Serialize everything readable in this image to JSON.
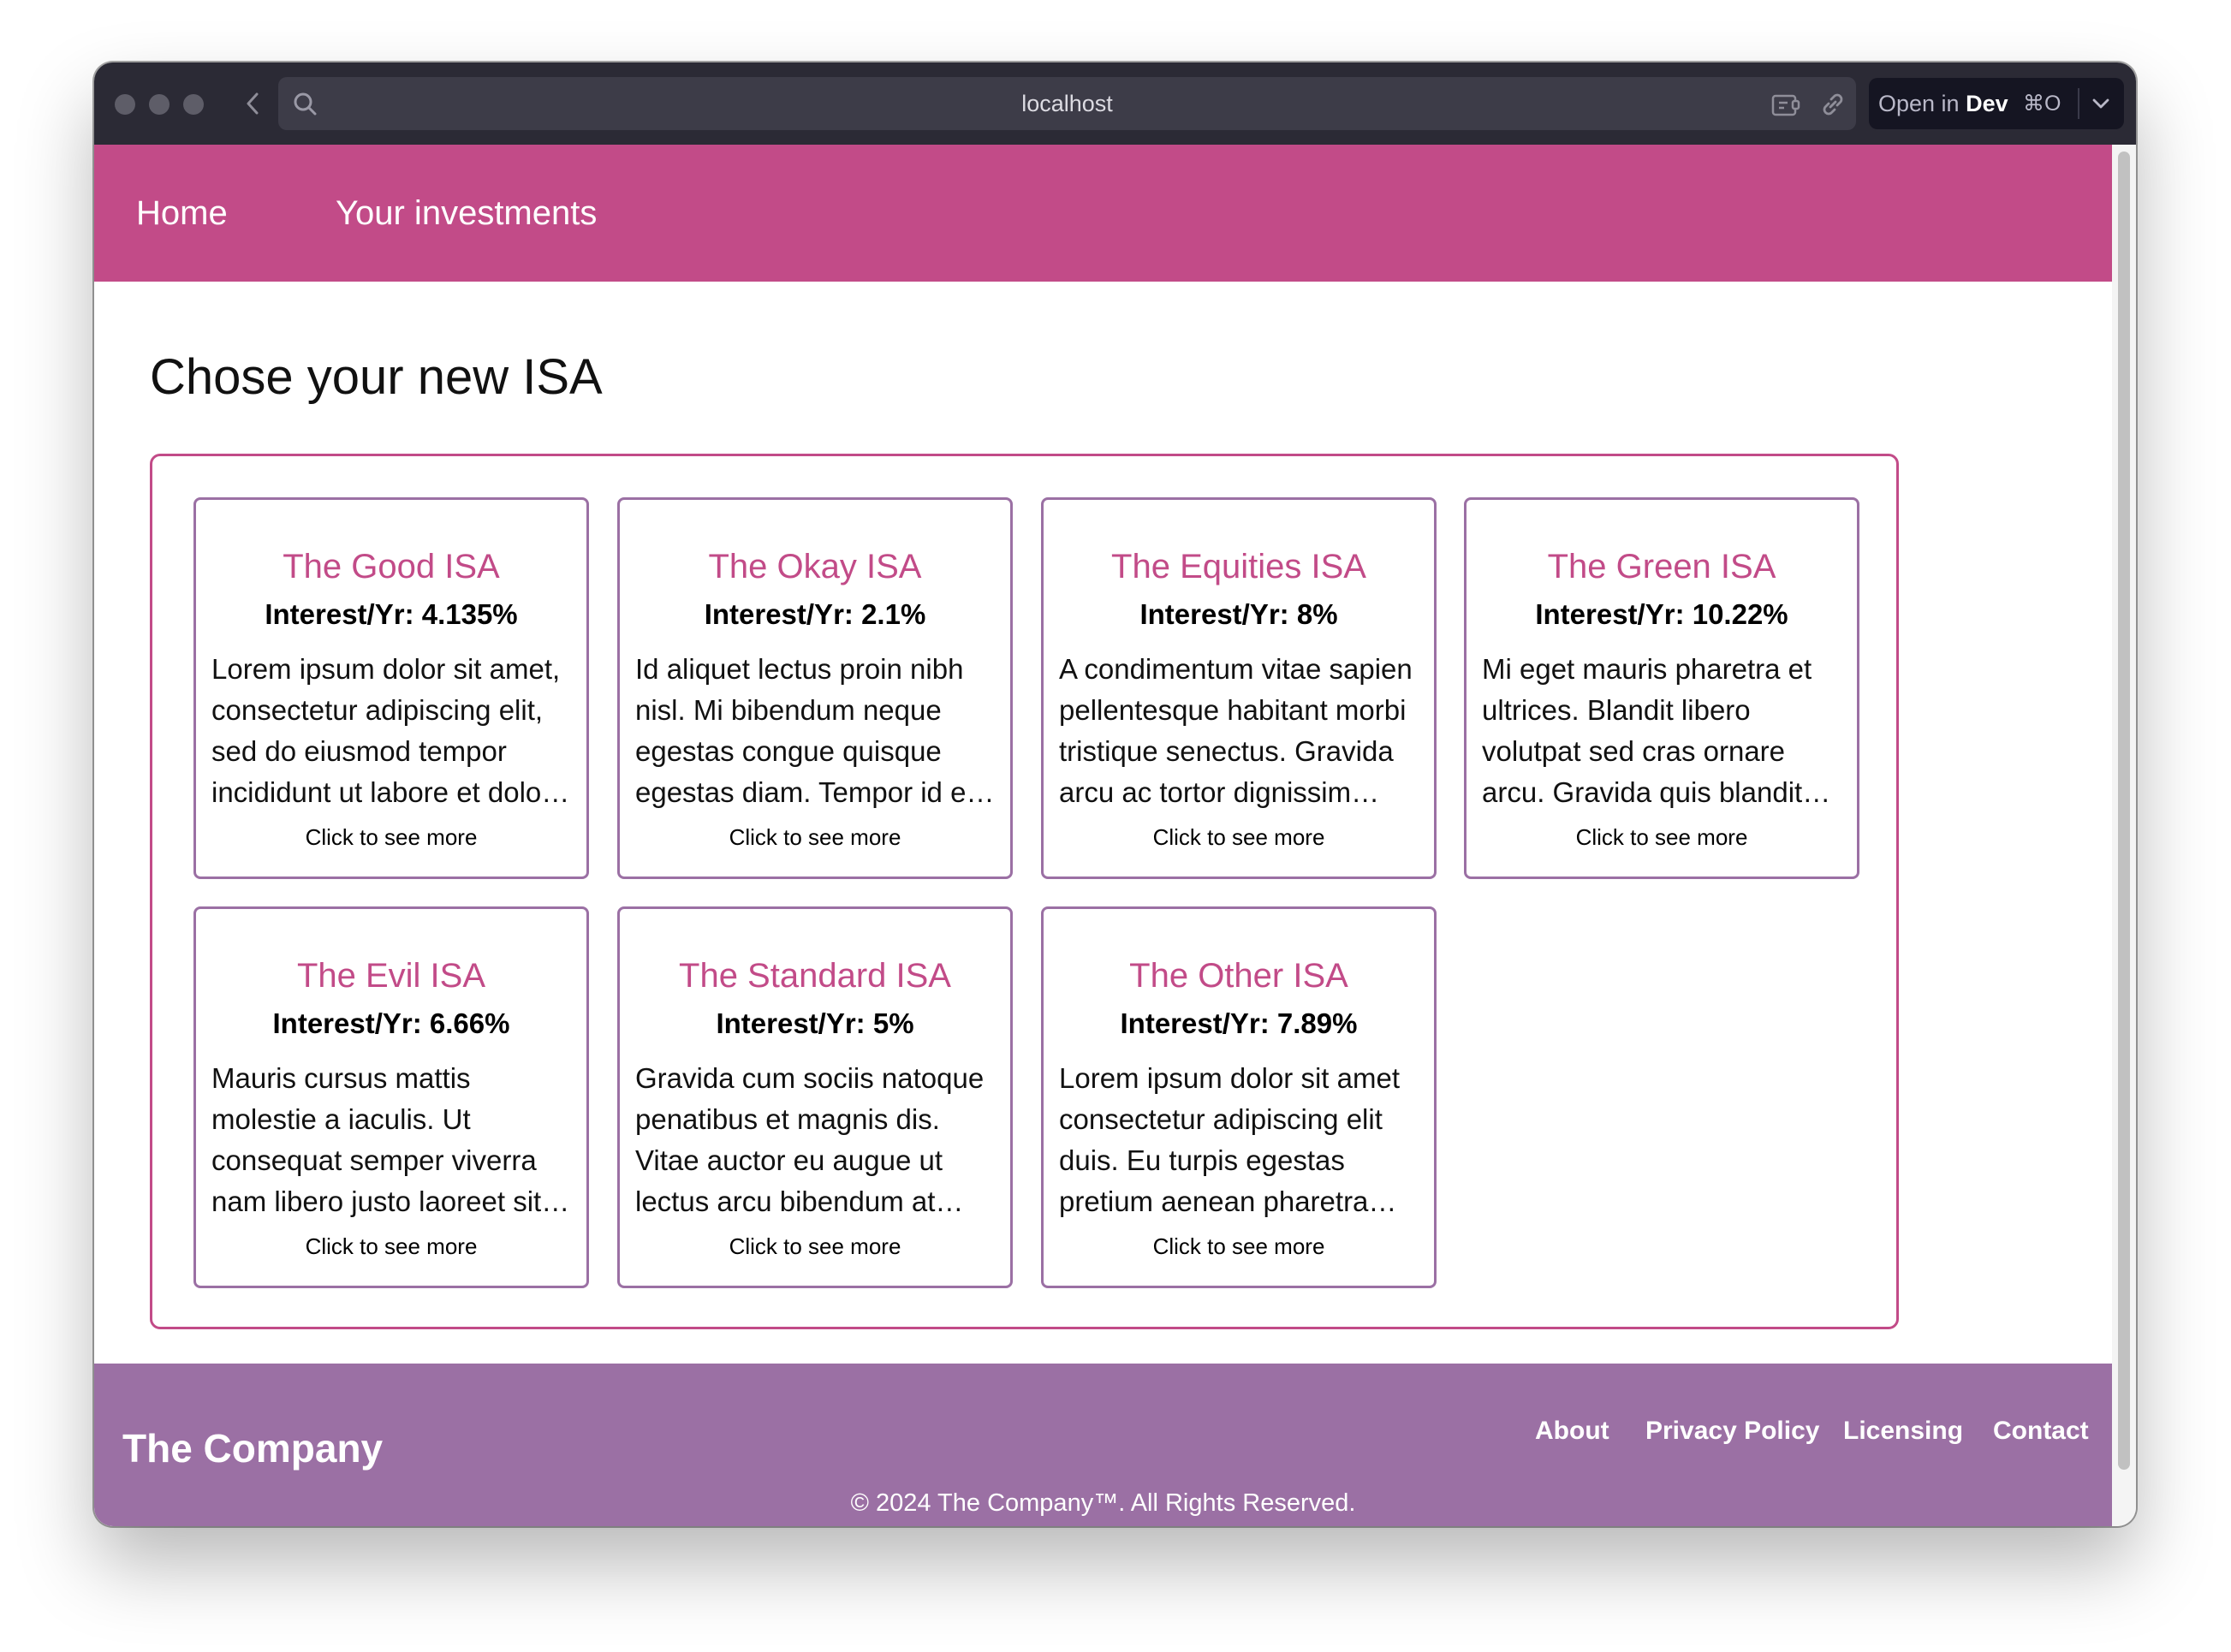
{
  "browser": {
    "url": "localhost",
    "open_in": "Open in",
    "open_target": "Dev",
    "shortcut": "⌘O"
  },
  "nav": {
    "home": "Home",
    "investments": "Your investments"
  },
  "main": {
    "title": "Chose your new ISA",
    "cards": [
      {
        "title": "The Good ISA",
        "rate": "Interest/Yr: 4.135%",
        "description": "Lorem ipsum dolor sit amet, consectetur adipiscing elit, sed do eiusmod tempor incididunt ut labore et dolore magna aliqua.",
        "more": "Click to see more"
      },
      {
        "title": "The Okay ISA",
        "rate": "Interest/Yr: 2.1%",
        "description": "Id aliquet lectus proin nibh nisl. Mi bibendum neque egestas congue quisque egestas diam. Tempor id eu nisl nunc.",
        "more": "Click to see more"
      },
      {
        "title": "The Equities ISA",
        "rate": "Interest/Yr: 8%",
        "description": "A condimentum vitae sapien pellentesque habitant morbi tristique senectus. Gravida arcu ac tortor dignissim convallis.",
        "more": "Click to see more"
      },
      {
        "title": "The Green ISA",
        "rate": "Interest/Yr: 10.22%",
        "description": "Mi eget mauris pharetra et ultrices. Blandit libero volutpat sed cras ornare arcu. Gravida quis blandit turpis cursus.",
        "more": "Click to see more"
      },
      {
        "title": "The Evil ISA",
        "rate": "Interest/Yr: 6.66%",
        "description": "Mauris cursus mattis molestie a iaculis. Ut consequat semper viverra nam libero justo laoreet sit. Amet consectetur.",
        "more": "Click to see more"
      },
      {
        "title": "The Standard ISA",
        "rate": "Interest/Yr: 5%",
        "description": "Gravida cum sociis natoque penatibus et magnis dis. Vitae auctor eu augue ut lectus arcu bibendum at varius vel.",
        "more": "Click to see more"
      },
      {
        "title": "The Other ISA",
        "rate": "Interest/Yr: 7.89%",
        "description": "Lorem ipsum dolor sit amet consectetur adipiscing elit duis. Eu turpis egestas pretium aenean pharetra magna ac.",
        "more": "Click to see more"
      }
    ]
  },
  "footer": {
    "brand": "The Company",
    "links": [
      "About",
      "Privacy Policy",
      "Licensing",
      "Contact"
    ],
    "copyright": "© 2024 The Company™. All Rights Reserved."
  },
  "colors": {
    "nav_bg": "#c24b88",
    "accent": "#c24b88",
    "card_border": "#9b70a4",
    "footer_bg": "#9b70a4",
    "chrome_bg": "#2b2a35"
  }
}
